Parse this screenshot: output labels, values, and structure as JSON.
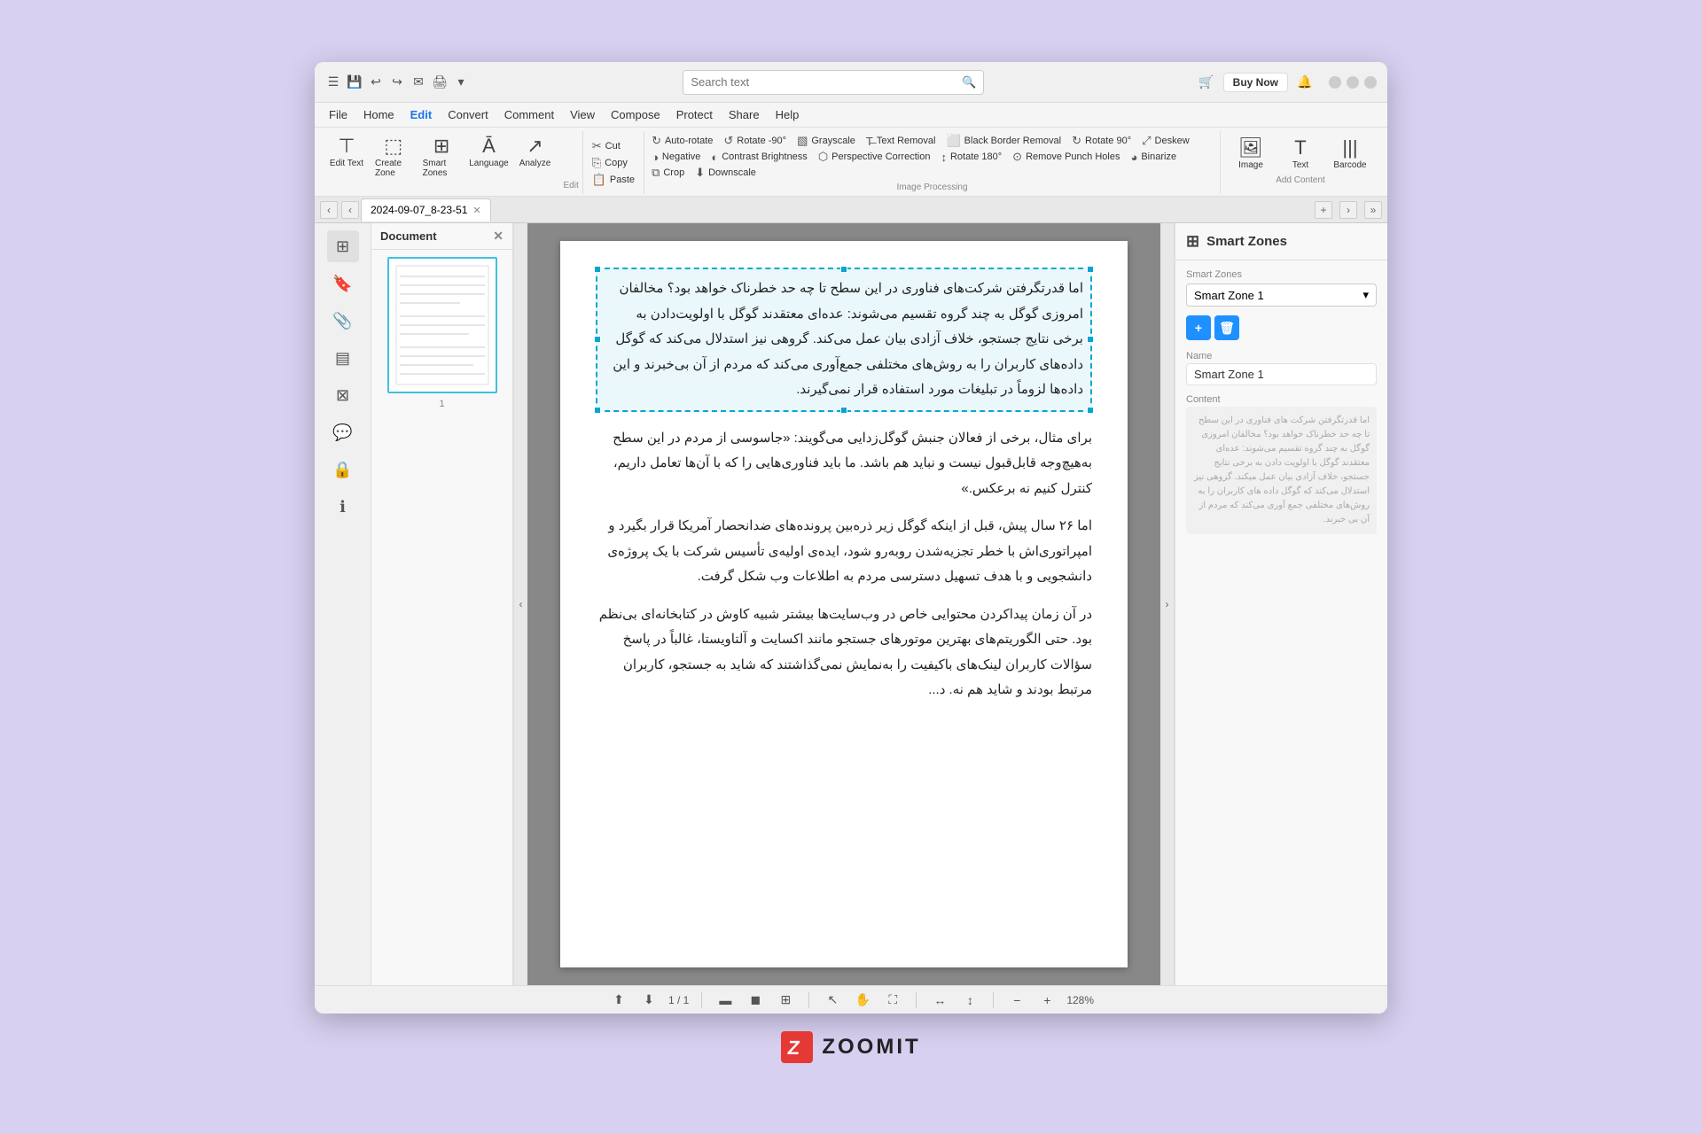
{
  "titlebar": {
    "search_placeholder": "Search text",
    "buy_now": "Buy Now"
  },
  "menu": {
    "items": [
      "File",
      "Home",
      "Edit",
      "Convert",
      "Comment",
      "View",
      "Compose",
      "Protect",
      "Share",
      "Help"
    ],
    "active": "Edit"
  },
  "toolbar": {
    "edit_group": {
      "label": "Edit",
      "buttons": [
        {
          "icon": "⊤",
          "label": "Edit Text"
        },
        {
          "icon": "⬚",
          "label": "Create Zone"
        },
        {
          "icon": "⊞",
          "label": "Smart Zones"
        },
        {
          "icon": "A̲",
          "label": "Language"
        },
        {
          "icon": "↗",
          "label": "Analyze"
        }
      ]
    },
    "clipboard": {
      "cut": "Cut",
      "copy": "Copy",
      "paste": "Paste"
    },
    "autorotate": "Auto-rotate",
    "rotate_neg90": "Rotate -90°",
    "rotate_90": "Rotate 90°",
    "deskew": "Deskew",
    "rotate_180": "Rotate 180°",
    "remove_punch_holes": "Remove Punch Holes",
    "grayscale": "Grayscale",
    "text_removal": "Text Removal",
    "black_border_removal": "Black Border Removal",
    "negative": "Negative",
    "contrast_brightness": "Contrast Brightness",
    "perspective_correction": "Perspective Correction",
    "binarize": "Binarize",
    "crop": "Crop",
    "downscale": "Downscale",
    "image_processing_label": "Image Processing",
    "add_content": {
      "label": "Add Content",
      "image": "Image",
      "text": "Text",
      "barcode": "Barcode"
    }
  },
  "tab": {
    "name": "2024-09-07_8-23-51"
  },
  "thumbnail": {
    "title": "Document",
    "page_label": "1"
  },
  "document": {
    "paragraph1": "اما قدرتگرفتن شرکت‌های فناوری در این سطح تا چه حد خطرناک خواهد بود؟ مخالفان امروزی گوگل به چند گروه تقسیم می‌شوند: عده‌ای معتقدند گوگل با اولویت‌دادن به برخی نتایج جستجو، خلاف آزادی بیان عمل می‌کند. گروهی نیز استدلال می‌کند که گوگل داده‌های کاربران را به روش‌های مختلفی جمع‌آوری می‌کند که مردم از آن بی‌خبرند و این داده‌ها لزوماً در تبلیغات مورد استفاده قرار نمی‌گیرند.",
    "paragraph2": "برای مثال، برخی از فعالان جنبش گوگل‌زدایی می‌گویند: «جاسوسی از مردم در این سطح به‌هیچ‌وجه قابل‌قبول نیست و نباید هم باشد. ما باید فناوری‌هایی را که با آن‌ها تعامل داریم، کنترل کنیم نه برعکس.»",
    "paragraph3": "اما ۲۶ سال پیش، قبل از اینکه گوگل زیر ذره‌بین پرونده‌های ضدانحصار آمریکا قرار بگیرد و امپراتوری‌اش با خطر تجزیه‌شدن روبه‌رو شود، ایده‌ی اولیه‌ی تأسیس شرکت با یک پروژه‌ی دانشجویی و با هدف تسهیل دسترسی مردم به اطلاعات وب شکل گرفت.",
    "paragraph4": "در آن زمان پیداکردن محتوایی خاص در وب‌سایت‌ها بیشتر شبیه کاوش در کتابخانه‌ای بی‌نظم بود. حتی الگوریتم‌های بهترین موتورهای جستجو مانند اکسایت و آلتاویستا، غالباً در پاسخ سؤالات کاربران لینک‌های باکیفیت را به‌نمایش نمی‌گذاشتند که شاید به جستجو، کاربران مرتبط بودند و شاید هم نه. د..."
  },
  "smart_zones": {
    "title": "Smart Zones",
    "zone_label": "Smart Zones",
    "zone_name": "Smart Zone 1",
    "name_label": "Name",
    "name_value": "Smart Zone 1",
    "content_label": "Content",
    "content_text": "اما قدرتگرفتن شرکت های فناوری در این سطح تا چه حد خطرناک خواهد بود؟ مخالفان امروزی گوگل به چند گروه تقسیم می‌شوند: عده‌ای معتقدند گوگل با اولویت دادن به برخی نتایج جستجو، خلاف آزادی بیان عمل میکند. گروهی نیز استدلال می‌کند که گوگل داده های کاربران را به روش‌های مختلفی جمع آوری می‌کند که مردم از آن بی خبرند."
  },
  "statusbar": {
    "page_info": "1 / 1",
    "zoom": "128%"
  },
  "brand": {
    "name": "ZOOMIT"
  }
}
